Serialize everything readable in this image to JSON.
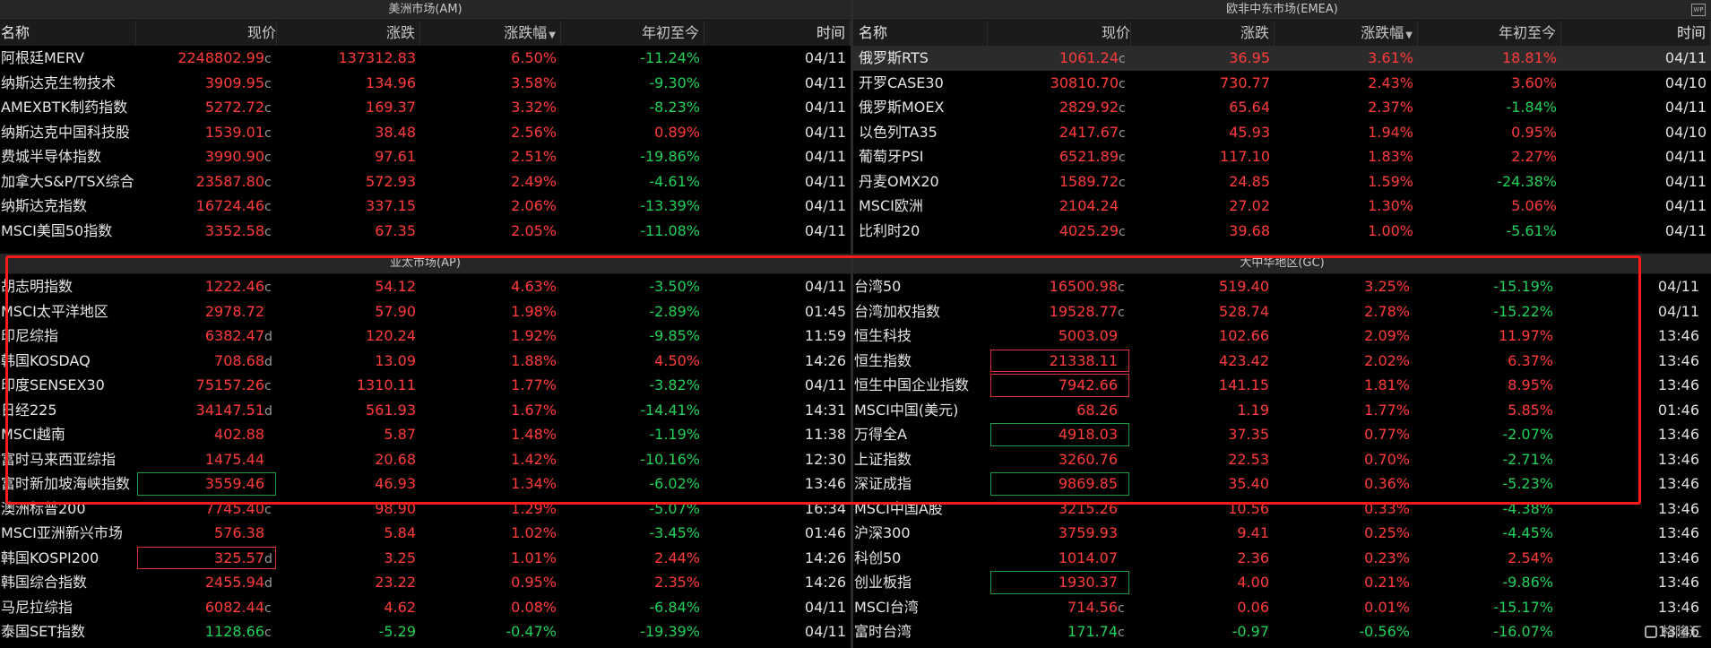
{
  "columns": {
    "name": "名称",
    "price": "现价",
    "change": "涨跌",
    "pct": "涨跌幅",
    "ytd": "年初至今",
    "time": "时间"
  },
  "am": {
    "title": "美洲市场(AM)",
    "rows": [
      {
        "name": "阿根廷MERV",
        "price": "2248802.99",
        "sfx": "c",
        "chg": "137312.83",
        "pct": "6.50%",
        "ytd": "-11.24%",
        "time": "04/11",
        "pc": "red",
        "yc": "green"
      },
      {
        "name": "纳斯达克生物技术",
        "price": "3909.95",
        "sfx": "c",
        "chg": "134.96",
        "pct": "3.58%",
        "ytd": "-9.30%",
        "time": "04/11",
        "pc": "red",
        "yc": "green"
      },
      {
        "name": "AMEXBTK制药指数",
        "price": "5272.72",
        "sfx": "c",
        "chg": "169.37",
        "pct": "3.32%",
        "ytd": "-8.23%",
        "time": "04/11",
        "pc": "red",
        "yc": "green"
      },
      {
        "name": "纳斯达克中国科技股",
        "price": "1539.01",
        "sfx": "c",
        "chg": "38.48",
        "pct": "2.56%",
        "ytd": "0.89%",
        "time": "04/11",
        "pc": "red",
        "yc": "red"
      },
      {
        "name": "费城半导体指数",
        "price": "3990.90",
        "sfx": "c",
        "chg": "97.61",
        "pct": "2.51%",
        "ytd": "-19.86%",
        "time": "04/11",
        "pc": "red",
        "yc": "green"
      },
      {
        "name": "加拿大S&P/TSX综合",
        "price": "23587.80",
        "sfx": "c",
        "chg": "572.93",
        "pct": "2.49%",
        "ytd": "-4.61%",
        "time": "04/11",
        "pc": "red",
        "yc": "green"
      },
      {
        "name": "纳斯达克指数",
        "price": "16724.46",
        "sfx": "c",
        "chg": "337.15",
        "pct": "2.06%",
        "ytd": "-13.39%",
        "time": "04/11",
        "pc": "red",
        "yc": "green"
      },
      {
        "name": "MSCI美国50指数",
        "price": "3352.58",
        "sfx": "c",
        "chg": "67.35",
        "pct": "2.05%",
        "ytd": "-11.08%",
        "time": "04/11",
        "pc": "red",
        "yc": "green"
      }
    ]
  },
  "emea": {
    "title": "欧非中东市场(EMEA)",
    "rows": [
      {
        "name": "俄罗斯RTS",
        "price": "1061.24",
        "sfx": "c",
        "chg": "36.95",
        "pct": "3.61%",
        "ytd": "18.81%",
        "time": "04/11",
        "pc": "red",
        "yc": "red",
        "hl": true
      },
      {
        "name": "开罗CASE30",
        "price": "30810.70",
        "sfx": "c",
        "chg": "730.77",
        "pct": "2.43%",
        "ytd": "3.60%",
        "time": "04/10",
        "pc": "red",
        "yc": "red"
      },
      {
        "name": "俄罗斯MOEX",
        "price": "2829.92",
        "sfx": "c",
        "chg": "65.64",
        "pct": "2.37%",
        "ytd": "-1.84%",
        "time": "04/11",
        "pc": "red",
        "yc": "green"
      },
      {
        "name": "以色列TA35",
        "price": "2417.67",
        "sfx": "c",
        "chg": "45.93",
        "pct": "1.94%",
        "ytd": "0.95%",
        "time": "04/10",
        "pc": "red",
        "yc": "red"
      },
      {
        "name": "葡萄牙PSI",
        "price": "6521.89",
        "sfx": "c",
        "chg": "117.10",
        "pct": "1.83%",
        "ytd": "2.27%",
        "time": "04/11",
        "pc": "red",
        "yc": "red"
      },
      {
        "name": "丹麦OMX20",
        "price": "1589.72",
        "sfx": "c",
        "chg": "24.85",
        "pct": "1.59%",
        "ytd": "-24.38%",
        "time": "04/11",
        "pc": "red",
        "yc": "green"
      },
      {
        "name": "MSCI欧洲",
        "price": "2104.24",
        "sfx": "",
        "chg": "27.02",
        "pct": "1.30%",
        "ytd": "5.06%",
        "time": "04/11",
        "pc": "red",
        "yc": "red"
      },
      {
        "name": "比利时20",
        "price": "4025.29",
        "sfx": "c",
        "chg": "39.68",
        "pct": "1.00%",
        "ytd": "-5.61%",
        "time": "04/11",
        "pc": "red",
        "yc": "green"
      }
    ]
  },
  "ap": {
    "title": "亚太市场(AP)",
    "rows": [
      {
        "name": "胡志明指数",
        "price": "1222.46",
        "sfx": "c",
        "chg": "54.12",
        "pct": "4.63%",
        "ytd": "-3.50%",
        "time": "04/11",
        "pc": "red",
        "yc": "green"
      },
      {
        "name": "MSCI太平洋地区",
        "price": "2978.72",
        "sfx": "",
        "chg": "57.90",
        "pct": "1.98%",
        "ytd": "-2.89%",
        "time": "01:45",
        "pc": "red",
        "yc": "green"
      },
      {
        "name": "印尼综指",
        "price": "6382.47",
        "sfx": "d",
        "chg": "120.24",
        "pct": "1.92%",
        "ytd": "-9.85%",
        "time": "11:59",
        "pc": "red",
        "yc": "green"
      },
      {
        "name": "韩国KOSDAQ",
        "price": "708.68",
        "sfx": "d",
        "chg": "13.09",
        "pct": "1.88%",
        "ytd": "4.50%",
        "time": "14:26",
        "pc": "red",
        "yc": "red"
      },
      {
        "name": "印度SENSEX30",
        "price": "75157.26",
        "sfx": "c",
        "chg": "1310.11",
        "pct": "1.77%",
        "ytd": "-3.82%",
        "time": "04/11",
        "pc": "red",
        "yc": "green"
      },
      {
        "name": "日经225",
        "price": "34147.51",
        "sfx": "d",
        "chg": "561.93",
        "pct": "1.67%",
        "ytd": "-14.41%",
        "time": "14:31",
        "pc": "red",
        "yc": "green"
      },
      {
        "name": "MSCI越南",
        "price": "402.88",
        "sfx": "",
        "chg": "5.87",
        "pct": "1.48%",
        "ytd": "-1.19%",
        "time": "11:38",
        "pc": "red",
        "yc": "green"
      },
      {
        "name": "富时马来西亚综指",
        "price": "1475.44",
        "sfx": "",
        "chg": "20.68",
        "pct": "1.42%",
        "ytd": "-10.16%",
        "time": "12:30",
        "pc": "red",
        "yc": "green"
      },
      {
        "name": "富时新加坡海峡指数",
        "price": "3559.46",
        "sfx": "",
        "chg": "46.93",
        "pct": "1.34%",
        "ytd": "-6.02%",
        "time": "13:46",
        "pc": "red",
        "yc": "green",
        "box": "green"
      },
      {
        "name": "澳洲标普200",
        "price": "7745.40",
        "sfx": "c",
        "chg": "98.90",
        "pct": "1.29%",
        "ytd": "-5.07%",
        "time": "16:34",
        "pc": "red",
        "yc": "green"
      },
      {
        "name": "MSCI亚洲新兴市场",
        "price": "576.38",
        "sfx": "",
        "chg": "5.84",
        "pct": "1.02%",
        "ytd": "-3.45%",
        "time": "01:46",
        "pc": "red",
        "yc": "green"
      },
      {
        "name": "韩国KOSPI200",
        "price": "325.57",
        "sfx": "d",
        "chg": "3.25",
        "pct": "1.01%",
        "ytd": "2.44%",
        "time": "14:26",
        "pc": "red",
        "yc": "red",
        "box": "red"
      },
      {
        "name": "韩国综合指数",
        "price": "2455.94",
        "sfx": "d",
        "chg": "23.22",
        "pct": "0.95%",
        "ytd": "2.35%",
        "time": "14:26",
        "pc": "red",
        "yc": "red"
      },
      {
        "name": "马尼拉综指",
        "price": "6082.44",
        "sfx": "c",
        "chg": "4.62",
        "pct": "0.08%",
        "ytd": "-6.84%",
        "time": "04/11",
        "pc": "red",
        "yc": "green"
      },
      {
        "name": "泰国SET指数",
        "price": "1128.66",
        "sfx": "c",
        "chg": "-5.29",
        "pct": "-0.47%",
        "ytd": "-19.39%",
        "time": "04/11",
        "pc": "green",
        "yc": "green"
      }
    ]
  },
  "gc": {
    "title": "大中华地区(GC)",
    "rows": [
      {
        "name": "台湾50",
        "price": "16500.98",
        "sfx": "c",
        "chg": "519.40",
        "pct": "3.25%",
        "ytd": "-15.19%",
        "time": "04/11",
        "pc": "red",
        "yc": "green"
      },
      {
        "name": "台湾加权指数",
        "price": "19528.77",
        "sfx": "c",
        "chg": "528.74",
        "pct": "2.78%",
        "ytd": "-15.22%",
        "time": "04/11",
        "pc": "red",
        "yc": "green"
      },
      {
        "name": "恒生科技",
        "price": "5003.09",
        "sfx": "",
        "chg": "102.66",
        "pct": "2.09%",
        "ytd": "11.97%",
        "time": "13:46",
        "pc": "red",
        "yc": "red"
      },
      {
        "name": "恒生指数",
        "price": "21338.11",
        "sfx": "",
        "chg": "423.42",
        "pct": "2.02%",
        "ytd": "6.37%",
        "time": "13:46",
        "pc": "red",
        "yc": "red",
        "box": "red"
      },
      {
        "name": "恒生中国企业指数",
        "price": "7942.66",
        "sfx": "",
        "chg": "141.15",
        "pct": "1.81%",
        "ytd": "8.95%",
        "time": "13:46",
        "pc": "red",
        "yc": "red",
        "box": "red"
      },
      {
        "name": "MSCI中国(美元)",
        "price": "68.26",
        "sfx": "",
        "chg": "1.19",
        "pct": "1.77%",
        "ytd": "5.85%",
        "time": "01:46",
        "pc": "red",
        "yc": "red"
      },
      {
        "name": "万得全A",
        "price": "4918.03",
        "sfx": "",
        "chg": "37.35",
        "pct": "0.77%",
        "ytd": "-2.07%",
        "time": "13:46",
        "pc": "red",
        "yc": "green",
        "box": "green"
      },
      {
        "name": "上证指数",
        "price": "3260.76",
        "sfx": "",
        "chg": "22.53",
        "pct": "0.70%",
        "ytd": "-2.71%",
        "time": "13:46",
        "pc": "red",
        "yc": "green"
      },
      {
        "name": "深证成指",
        "price": "9869.85",
        "sfx": "",
        "chg": "35.40",
        "pct": "0.36%",
        "ytd": "-5.23%",
        "time": "13:46",
        "pc": "red",
        "yc": "green",
        "box": "green"
      },
      {
        "name": "MSCI中国A股",
        "price": "3215.26",
        "sfx": "",
        "chg": "10.56",
        "pct": "0.33%",
        "ytd": "-4.38%",
        "time": "13:46",
        "pc": "red",
        "yc": "green"
      },
      {
        "name": "沪深300",
        "price": "3759.93",
        "sfx": "",
        "chg": "9.41",
        "pct": "0.25%",
        "ytd": "-4.45%",
        "time": "13:46",
        "pc": "red",
        "yc": "green"
      },
      {
        "name": "科创50",
        "price": "1014.07",
        "sfx": "",
        "chg": "2.36",
        "pct": "0.23%",
        "ytd": "2.54%",
        "time": "13:46",
        "pc": "red",
        "yc": "red"
      },
      {
        "name": "创业板指",
        "price": "1930.37",
        "sfx": "",
        "chg": "4.00",
        "pct": "0.21%",
        "ytd": "-9.86%",
        "time": "13:46",
        "pc": "red",
        "yc": "green",
        "box": "green"
      },
      {
        "name": "MSCI台湾",
        "price": "714.56",
        "sfx": "c",
        "chg": "0.06",
        "pct": "0.01%",
        "ytd": "-15.17%",
        "time": "13:46",
        "pc": "red",
        "yc": "green"
      },
      {
        "name": "富时台湾",
        "price": "171.74",
        "sfx": "c",
        "chg": "-0.97",
        "pct": "-0.56%",
        "ytd": "-16.07%",
        "time": "13:46",
        "pc": "green",
        "yc": "green"
      }
    ]
  },
  "watermark": "格隆汇",
  "corner_icon": "window-icon",
  "colors": {
    "up": "#ff3b3b",
    "down": "#1fd15a",
    "annotation": "#ff1a1a",
    "background": "#000000"
  }
}
